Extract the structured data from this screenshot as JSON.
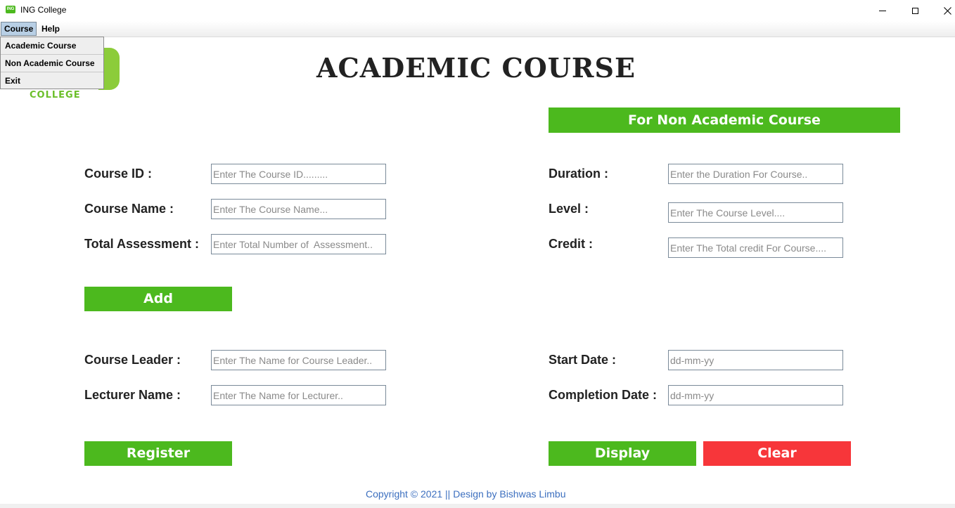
{
  "window": {
    "title": "ING College",
    "app_icon": "ing-app-icon"
  },
  "menu": {
    "items": [
      "Course",
      "Help"
    ],
    "dropdown": [
      "Academic Course",
      "Non Academic Course",
      "Exit"
    ]
  },
  "logo": {
    "text": "COLLEGE"
  },
  "page_title": "ACADEMIC COURSE",
  "buttons": {
    "non_academic": "For Non Academic Course",
    "add": "Add",
    "register": "Register",
    "display": "Display",
    "clear": "Clear"
  },
  "left_fields": [
    {
      "label": "Course ID :",
      "placeholder": "Enter The Course ID........."
    },
    {
      "label": "Course Name :",
      "placeholder": "Enter The Course Name..."
    },
    {
      "label": "Total Assessment :",
      "placeholder": "Enter Total Number of  Assessment.."
    }
  ],
  "right_fields": [
    {
      "label": "Duration :",
      "placeholder": "Enter the Duration For Course.."
    },
    {
      "label": "Level :",
      "placeholder": "Enter The Course Level...."
    },
    {
      "label": "Credit :",
      "placeholder": "Enter The Total credit For Course...."
    }
  ],
  "lower_left_fields": [
    {
      "label": "Course Leader :",
      "placeholder": "Enter The Name for Course Leader.."
    },
    {
      "label": "Lecturer Name :",
      "placeholder": "Enter The Name for Lecturer.."
    }
  ],
  "lower_right_fields": [
    {
      "label": "Start Date :",
      "placeholder": "dd-mm-yy"
    },
    {
      "label": "Completion Date :",
      "placeholder": "dd-mm-yy"
    }
  ],
  "footer": "Copyright © 2021 || Design by Bishwas Limbu",
  "colors": {
    "green": "#4cb91e",
    "red": "#f7363a",
    "footer_blue": "#3c6fbf"
  }
}
